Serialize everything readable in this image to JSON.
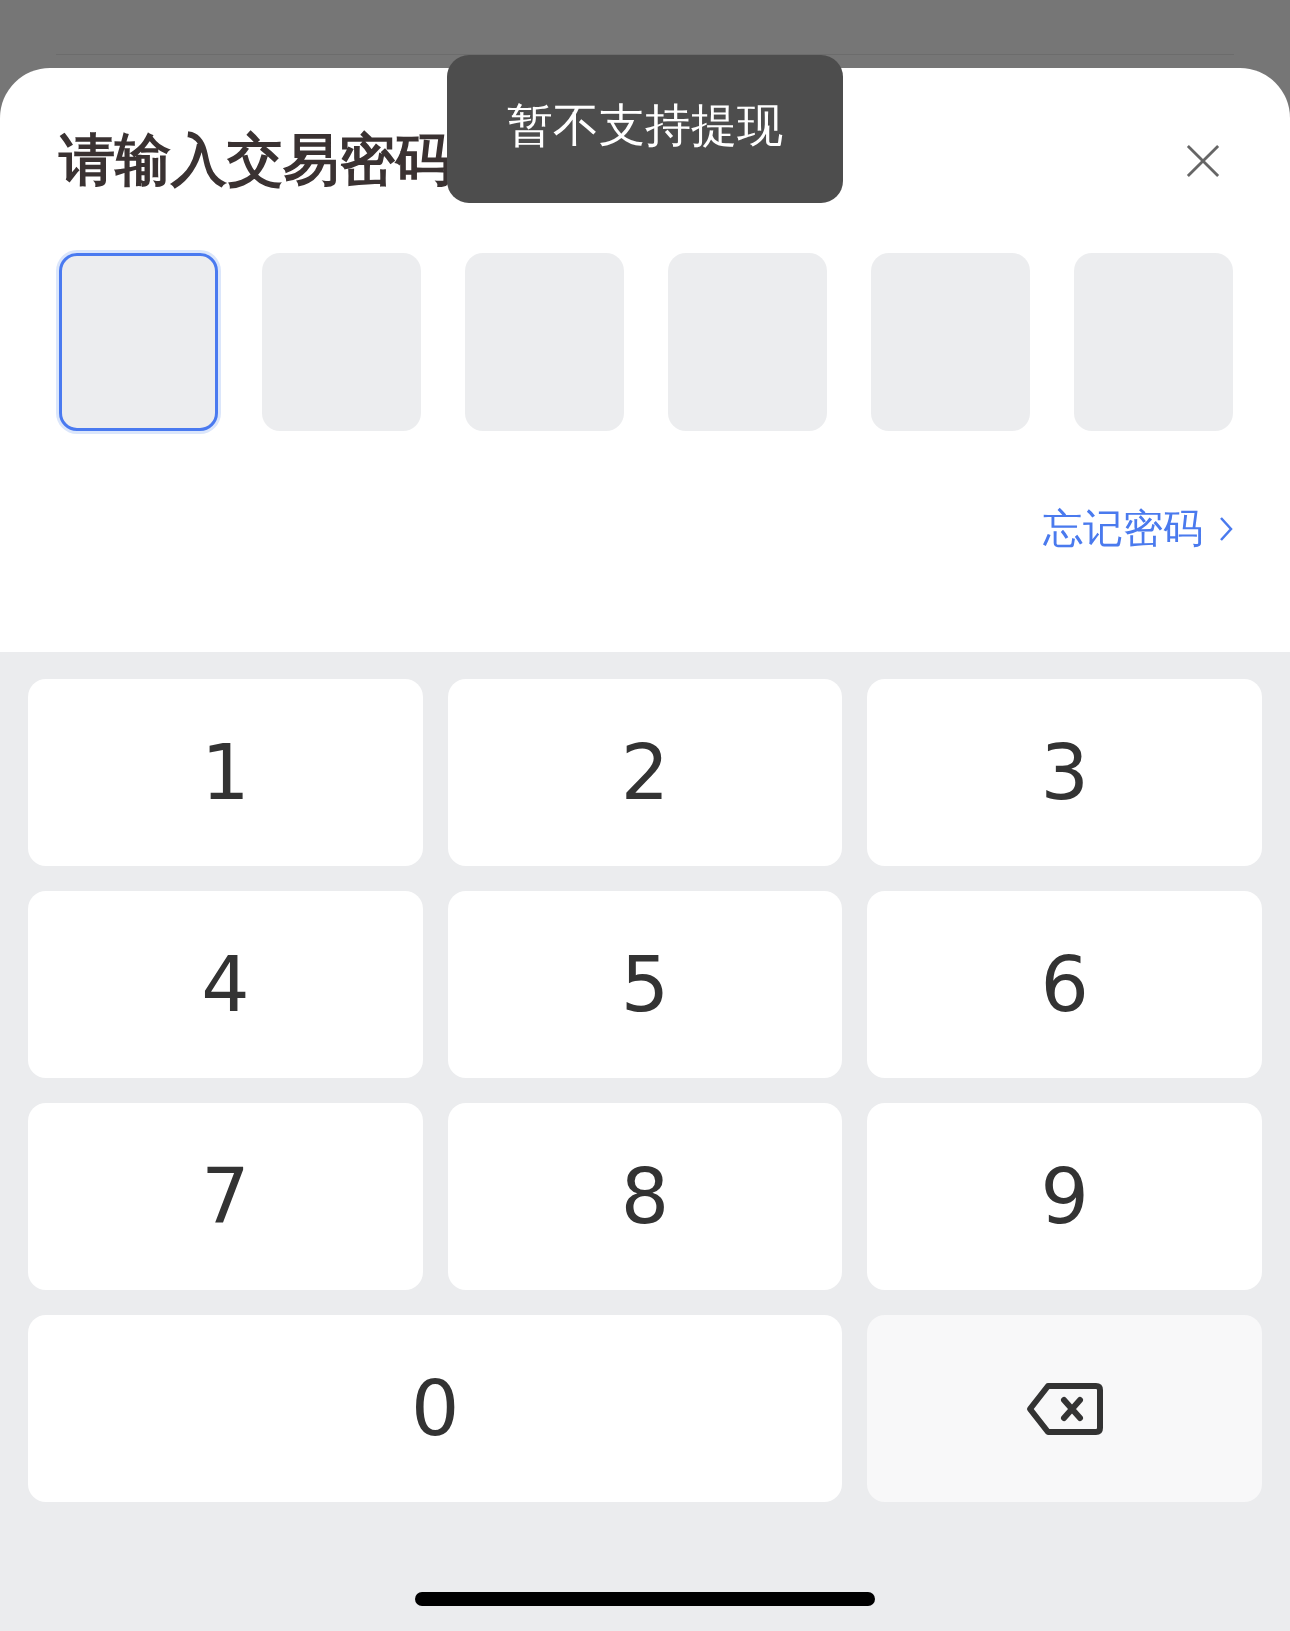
{
  "title": "请输入交易密码",
  "toast": "暂不支持提现",
  "pin_boxes": [
    {
      "selected": true
    },
    {
      "selected": false
    },
    {
      "selected": false
    },
    {
      "selected": false
    },
    {
      "selected": false
    },
    {
      "selected": false
    }
  ],
  "forgot_link": "忘记密码",
  "keys": [
    {
      "kind": "digit",
      "label": "1"
    },
    {
      "kind": "digit",
      "label": "2"
    },
    {
      "kind": "digit",
      "label": "3"
    },
    {
      "kind": "digit",
      "label": "4"
    },
    {
      "kind": "digit",
      "label": "5"
    },
    {
      "kind": "digit",
      "label": "6"
    },
    {
      "kind": "digit",
      "label": "7"
    },
    {
      "kind": "digit",
      "label": "8"
    },
    {
      "kind": "digit",
      "label": "9"
    },
    {
      "kind": "digit",
      "label": "0",
      "wide": true
    },
    {
      "kind": "delete"
    }
  ]
}
